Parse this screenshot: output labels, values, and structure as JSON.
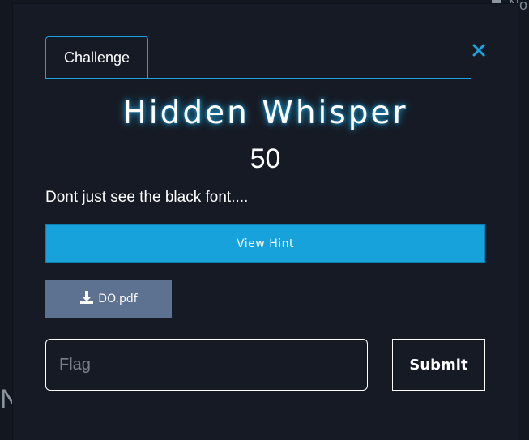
{
  "background": {
    "top_right_fragment": "No",
    "left_fragment": "N"
  },
  "modal": {
    "tab_label": "Challenge",
    "close_icon": "close-icon",
    "title": "Hidden Whisper",
    "points": "50",
    "description": "Dont just see the black font....",
    "hint_button_label": "View Hint",
    "file_icon": "download-icon",
    "file_label": "DO.pdf",
    "flag_placeholder": "Flag",
    "submit_label": "Submit"
  },
  "colors": {
    "accent": "#1aa3df",
    "modal_bg": "#161a24",
    "file_button_bg": "#5d7290"
  }
}
